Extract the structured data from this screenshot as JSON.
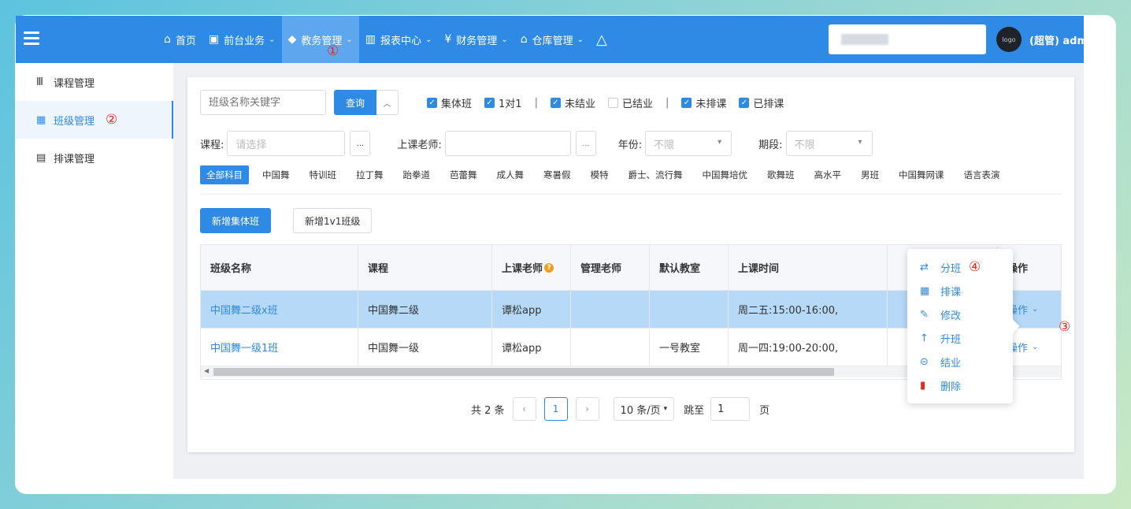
{
  "header": {
    "nav": [
      {
        "icon": "home-icon",
        "glyph": "⌂",
        "label": "首页",
        "dropdown": false
      },
      {
        "icon": "monitor-icon",
        "glyph": "▣",
        "label": "前台业务",
        "dropdown": true
      },
      {
        "icon": "graduation-cap-icon",
        "glyph": "◆",
        "label": "教务管理",
        "dropdown": true,
        "active": true
      },
      {
        "icon": "bar-chart-icon",
        "glyph": "▥",
        "label": "报表中心",
        "dropdown": true
      },
      {
        "icon": "yen-icon",
        "glyph": "¥",
        "label": "财务管理",
        "dropdown": true
      },
      {
        "icon": "warehouse-icon",
        "glyph": "⌂",
        "label": "仓库管理",
        "dropdown": true
      }
    ],
    "marker": "①",
    "user": {
      "avatar_text": "logo",
      "name": "(超管) adm"
    }
  },
  "sidebar": {
    "items": [
      {
        "label": "课程管理",
        "icon": "library-icon",
        "glyph": "Ⅲ"
      },
      {
        "label": "班级管理",
        "icon": "class-card-icon",
        "glyph": "▦",
        "active": true
      },
      {
        "label": "排课管理",
        "icon": "calendar-icon",
        "glyph": "▤"
      }
    ],
    "marker": "②"
  },
  "filters": {
    "keyword_placeholder": "班级名称关键字",
    "query_label": "查询",
    "collapse_glyph": "︿",
    "checkboxes": [
      {
        "label": "集体班",
        "checked": true
      },
      {
        "label": "1对1",
        "checked": true
      },
      {
        "label": "|",
        "sep": true
      },
      {
        "label": "未结业",
        "checked": true
      },
      {
        "label": "已结业",
        "checked": false
      },
      {
        "label": "|",
        "sep": true
      },
      {
        "label": "未排课",
        "checked": true
      },
      {
        "label": "已排课",
        "checked": true
      }
    ],
    "course_label": "课程:",
    "course_placeholder": "请选择",
    "dots": "...",
    "teacher_label": "上课老师:",
    "year_label": "年份:",
    "year_value": "不限",
    "term_label": "期段:",
    "term_value": "不限",
    "subjects": [
      "全部科目",
      "中国舞",
      "特训班",
      "拉丁舞",
      "跆拳道",
      "芭蕾舞",
      "成人舞",
      "寒暑假",
      "模特",
      "爵士、流行舞",
      "中国舞培优",
      "歌舞班",
      "高水平",
      "男班",
      "中国舞网课",
      "语言表演"
    ],
    "active_subject": "全部科目"
  },
  "actions": {
    "add_group": "新增集体班",
    "add_1v1": "新增1v1班级"
  },
  "table": {
    "headers": [
      "班级名称",
      "课程",
      "上课老师",
      "管理老师",
      "默认教室",
      "上课时间",
      "",
      "操作"
    ],
    "rows": [
      {
        "name": "中国舞二级x班",
        "course": "中国舞二级",
        "teacher": "谭松app",
        "manager": "",
        "room": "",
        "time": "周二五:15:00-16:00,",
        "op": "操作"
      },
      {
        "name": "中国舞一级1班",
        "course": "中国舞一级",
        "teacher": "谭松app",
        "manager": "",
        "room": "一号教室",
        "time": "周一四:19:00-20:00,",
        "op": "操作"
      }
    ],
    "op_marker": "③"
  },
  "menu": {
    "items": [
      {
        "label": "分班",
        "icon": "transfer-icon",
        "glyph": "⇄"
      },
      {
        "label": "排课",
        "icon": "calendar-icon",
        "glyph": "▦"
      },
      {
        "label": "修改",
        "icon": "pencil-icon",
        "glyph": "✎"
      },
      {
        "label": "升班",
        "icon": "arrow-up-icon",
        "glyph": "↑"
      },
      {
        "label": "结业",
        "icon": "exit-icon",
        "glyph": "⊝"
      },
      {
        "label": "删除",
        "icon": "trash-icon",
        "glyph": "▮"
      }
    ],
    "marker": "④"
  },
  "pagination": {
    "total": "共 2 条",
    "current": "1",
    "page_size": "10 条/页",
    "jump_label": "跳至",
    "jump_value": "1",
    "page_unit": "页"
  },
  "colors": {
    "primary": "#2f8ae6",
    "selected_row": "#b6d9f7",
    "danger": "#e8261c",
    "help": "#f0a020"
  }
}
